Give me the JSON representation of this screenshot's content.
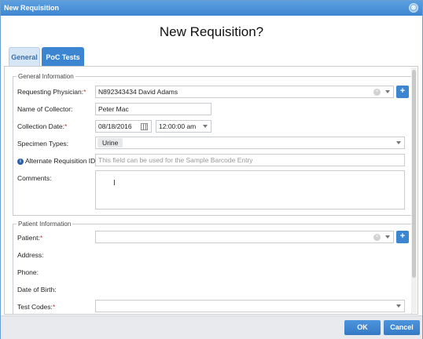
{
  "window": {
    "title": "New Requisition",
    "close_glyph": "⊗"
  },
  "heading": "New Requisition?",
  "tabs": [
    {
      "label": "General"
    },
    {
      "label": "PoC Tests"
    }
  ],
  "general_info": {
    "legend": "General Information",
    "requesting_physician": {
      "label": "Requesting Physician:",
      "value": "N892343434  David Adams"
    },
    "collector": {
      "label": "Name of Collector:",
      "value": "Peter Mac"
    },
    "collection_date": {
      "label": "Collection Date:",
      "date": "08/18/2016",
      "time": "12:00:00 am"
    },
    "specimen_types": {
      "label": "Specimen Types:",
      "value": "Urine"
    },
    "alternate_id": {
      "label": "Alternate Requisition ID:",
      "placeholder": "This field can be used for the Sample Barcode Entry"
    },
    "comments": {
      "label": "Comments:",
      "cursor": "I"
    }
  },
  "patient_info": {
    "legend": "Patient Information",
    "patient": {
      "label": "Patient:"
    },
    "address": {
      "label": "Address:"
    },
    "phone": {
      "label": "Phone:"
    },
    "dob": {
      "label": "Date of Birth:"
    },
    "test_codes": {
      "label": "Test Codes:"
    }
  },
  "common": {
    "required_mark": "*",
    "add_glyph": "+",
    "clear_glyph": "×",
    "info_glyph": "i"
  },
  "footer": {
    "ok": "OK",
    "cancel": "Cancel"
  },
  "colors": {
    "accent": "#3c86d1",
    "required": "#c0392b",
    "info": "#2a5fa5"
  }
}
